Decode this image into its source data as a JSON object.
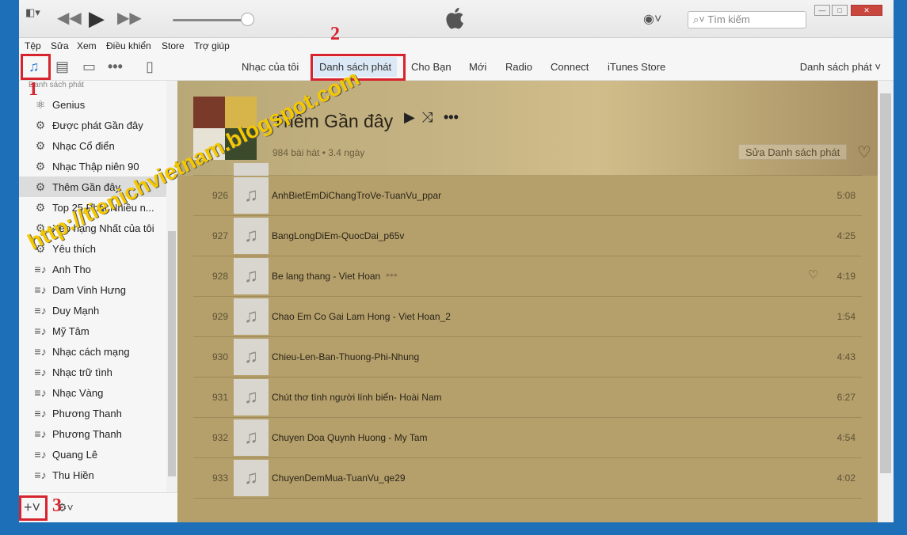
{
  "titlebar": {
    "search_placeholder": "Tìm kiếm"
  },
  "menubar": {
    "items": [
      "Tệp",
      "Sửa",
      "Xem",
      "Điều khiển",
      "Store",
      "Trợ giúp"
    ]
  },
  "navbar": {
    "tabs": [
      "Nhạc của tôi",
      "Danh sách phát",
      "Cho Bạn",
      "Mới",
      "Radio",
      "Connect",
      "iTunes Store"
    ],
    "active_tab": "Danh sách phát",
    "right_label": "Danh sách phát"
  },
  "sidebar": {
    "header": "Danh sách phát",
    "items": [
      {
        "label": "Genius",
        "icon": "genius-icon"
      },
      {
        "label": "Được phát Gần đây",
        "icon": "gear-icon"
      },
      {
        "label": "Nhạc Cổ điển",
        "icon": "gear-icon"
      },
      {
        "label": "Nhạc Thập niên 90",
        "icon": "gear-icon"
      },
      {
        "label": "Thêm Gần đây",
        "icon": "gear-icon"
      },
      {
        "label": "Top 25 Phát Nhiều n...",
        "icon": "gear-icon"
      },
      {
        "label": "Xếp hạng Nhất của tôi",
        "icon": "gear-icon"
      },
      {
        "label": "Yêu thích",
        "icon": "gear-icon"
      },
      {
        "label": "Anh Tho",
        "icon": "playlist-icon"
      },
      {
        "label": "Dam Vinh Hưng",
        "icon": "playlist-icon"
      },
      {
        "label": "Duy Mạnh",
        "icon": "playlist-icon"
      },
      {
        "label": "Mỹ Tâm",
        "icon": "playlist-icon"
      },
      {
        "label": "Nhạc cách mạng",
        "icon": "playlist-icon"
      },
      {
        "label": "Nhạc trữ tình",
        "icon": "playlist-icon"
      },
      {
        "label": "Nhạc Vàng",
        "icon": "playlist-icon"
      },
      {
        "label": "Phương Thanh",
        "icon": "playlist-icon"
      },
      {
        "label": "Phương Thanh",
        "icon": "playlist-icon"
      },
      {
        "label": "Quang Lê",
        "icon": "playlist-icon"
      },
      {
        "label": "Thu Hiền",
        "icon": "playlist-icon"
      }
    ],
    "selected_index": 4
  },
  "playlist": {
    "title": "Thêm Gần đây",
    "subtitle": "984 bài hát • 3.4 ngày",
    "edit_label": "Sửa Danh sách phát"
  },
  "songs": [
    {
      "num": "926",
      "title": "AnhBietEmDiChangTroVe-TuanVu_ppar",
      "duration": "5:08"
    },
    {
      "num": "927",
      "title": "BangLongDiEm-QuocDai_p65v",
      "duration": "4:25"
    },
    {
      "num": "928",
      "title": "Be lang thang - Viet Hoan",
      "duration": "4:19"
    },
    {
      "num": "929",
      "title": "Chao Em Co Gai Lam Hong - Viet Hoan_2",
      "duration": "1:54"
    },
    {
      "num": "930",
      "title": "Chieu-Len-Ban-Thuong-Phi-Nhung",
      "duration": "4:43"
    },
    {
      "num": "931",
      "title": "Chút thơ tình người lính biển- Hoài Nam",
      "duration": "6:27"
    },
    {
      "num": "932",
      "title": "Chuyen Doa Quynh Huong - My Tam",
      "duration": "4:54"
    },
    {
      "num": "933",
      "title": "ChuyenDemMua-TuanVu_qe29",
      "duration": "4:02"
    }
  ],
  "annotations": {
    "one": "1",
    "two": "2",
    "three": "3"
  },
  "watermark": {
    "text": "http://tienichvietnam.blogspot.com"
  },
  "colors": {
    "highlight_box": "#d7232e",
    "main_bg": "#b5a06b",
    "active_tab_bg": "#dbe8f6"
  }
}
